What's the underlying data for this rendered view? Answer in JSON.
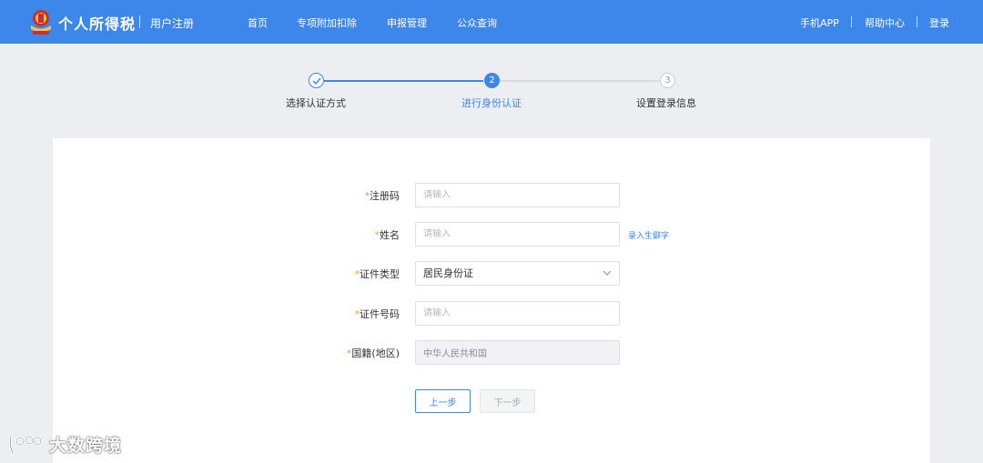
{
  "header": {
    "title": "个人所得税",
    "subtitle": "用户注册",
    "nav": [
      "首页",
      "专项附加扣除",
      "申报管理",
      "公众查询"
    ],
    "right_links": [
      "手机APP",
      "帮助中心",
      "登录"
    ],
    "colors": {
      "bar": "#3d86ea"
    }
  },
  "stepper": {
    "steps": [
      {
        "label": "选择认证方式",
        "status": "done"
      },
      {
        "label": "进行身份认证",
        "number": "2",
        "status": "active"
      },
      {
        "label": "设置登录信息",
        "number": "3",
        "status": "pending"
      }
    ]
  },
  "form": {
    "required_mark": "*",
    "fields": {
      "reg_code": {
        "label": "注册码",
        "placeholder": "请输入",
        "value": ""
      },
      "name": {
        "label": "姓名",
        "placeholder": "请输入",
        "value": "",
        "aux_link": "录入生僻字"
      },
      "id_type": {
        "label": "证件类型",
        "value": "居民身份证"
      },
      "id_number": {
        "label": "证件号码",
        "placeholder": "请输入",
        "value": ""
      },
      "nationality": {
        "label": "国籍(地区)",
        "value": "中华人民共和国"
      }
    },
    "buttons": {
      "prev": "上一步",
      "next": "下一步"
    }
  },
  "watermark": {
    "text": "大数跨境"
  }
}
